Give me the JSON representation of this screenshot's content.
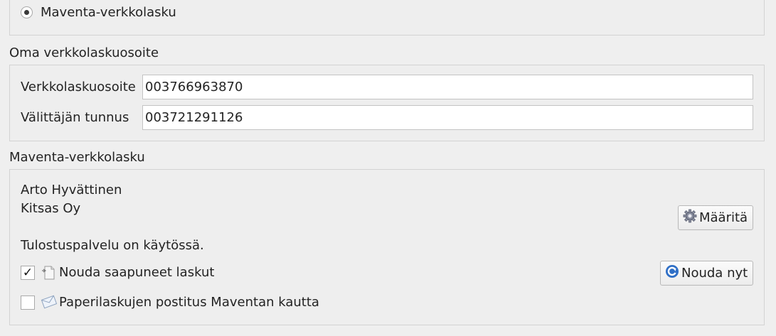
{
  "format_options": {
    "maventa_radio_label": "Maventa-verkkolasku"
  },
  "own_address": {
    "section_title": "Oma verkkolaskuosoite",
    "address_label": "Verkkolaskuosoite",
    "address_value": "003766963870",
    "operator_label": "Välittäjän tunnus",
    "operator_value": "003721291126"
  },
  "maventa": {
    "section_title": "Maventa-verkkolasku",
    "user_name": "Arto Hyvättinen",
    "company_name": "Kitsas Oy",
    "configure_button": "Määritä",
    "print_service_status": "Tulostuspalvelu on käytössä.",
    "fetch_checkbox_label": "Nouda saapuneet laskut",
    "fetch_checked": true,
    "fetch_now_button": "Nouda nyt",
    "paper_checkbox_label": "Paperilaskujen postitus Maventan kautta",
    "paper_checked": false
  },
  "icons": {
    "configure": "gear-icon",
    "fetch": "document-icon",
    "fetch_now": "refresh-icon",
    "paper": "envelope-icon"
  },
  "colors": {
    "background": "#efefef",
    "panel_border": "#d3d3d3",
    "refresh_blue": "#2f6fc6"
  }
}
